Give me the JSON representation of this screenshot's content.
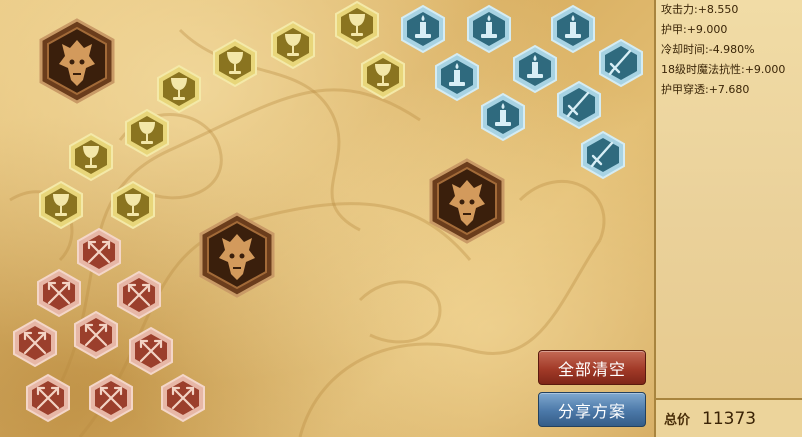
{
  "stats": [
    {
      "label": "攻击力",
      "value": "+8.550"
    },
    {
      "label": "护甲",
      "value": "+9.000"
    },
    {
      "label": "冷却时间",
      "value": "-4.980%"
    },
    {
      "label": "18级时魔法抗性",
      "value": "+9.000"
    },
    {
      "label": "护甲穿透",
      "value": "+7.680"
    }
  ],
  "buttons": {
    "clear": "全部清空",
    "share": "分享方案"
  },
  "total": {
    "label": "总价",
    "value": "11373"
  },
  "colors": {
    "red": "#c9735a",
    "yellow": "#d9b437",
    "blue": "#7fb2c8",
    "bronze": "#8a5a2a",
    "clear_button": "#a23a28",
    "share_button": "#4b78a8"
  },
  "runes": {
    "red": {
      "icon": "crossed-arrows-icon",
      "count": 9
    },
    "yellow": {
      "icon": "chalice-icon",
      "count": 9
    },
    "blue": [
      {
        "icon": "candle-icon",
        "count": 6
      },
      {
        "icon": "sword-icon",
        "count": 3
      }
    ],
    "keystone": {
      "icon": "dragon-head-icon",
      "count": 3
    }
  }
}
